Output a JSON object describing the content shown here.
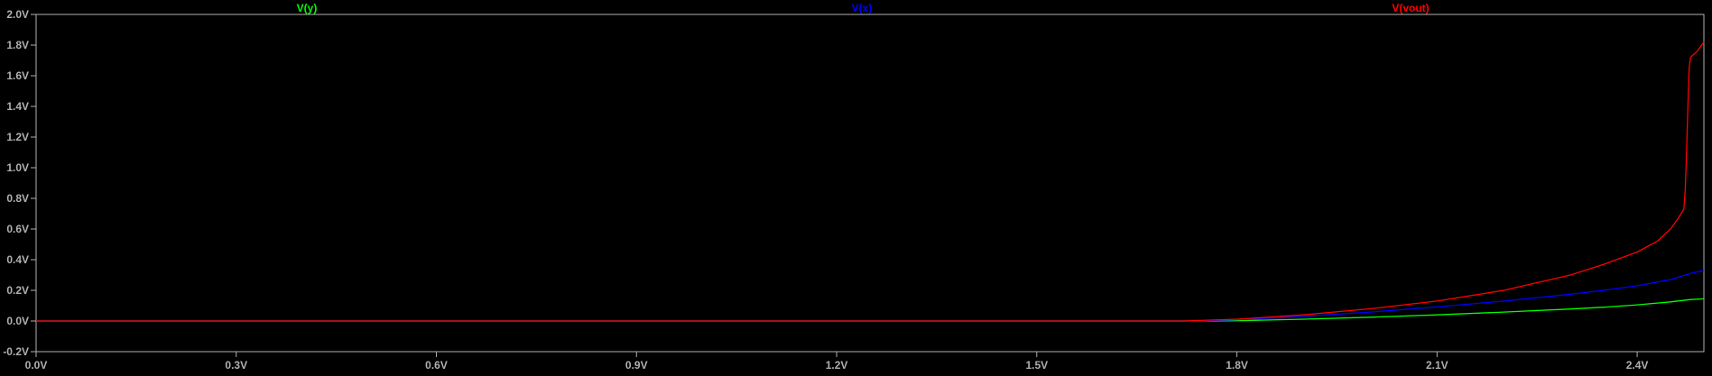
{
  "chart_data": {
    "type": "line",
    "title": "",
    "xlabel": "",
    "ylabel": "",
    "xlim": [
      0.0,
      2.5
    ],
    "ylim": [
      -0.2,
      2.0
    ],
    "grid": false,
    "legend": "top",
    "background": "#000000",
    "axis_color": "#b0b0b0",
    "x_ticks": [
      "0.0V",
      "0.3V",
      "0.6V",
      "0.9V",
      "1.2V",
      "1.5V",
      "1.8V",
      "2.1V",
      "2.4V"
    ],
    "x_tick_values": [
      0.0,
      0.3,
      0.6,
      0.9,
      1.2,
      1.5,
      1.8,
      2.1,
      2.4
    ],
    "y_ticks": [
      "-0.2V",
      "0.0V",
      "0.2V",
      "0.4V",
      "0.6V",
      "0.8V",
      "1.0V",
      "1.2V",
      "1.4V",
      "1.6V",
      "1.8V",
      "2.0V"
    ],
    "y_tick_values": [
      -0.2,
      0.0,
      0.2,
      0.4,
      0.6,
      0.8,
      1.0,
      1.2,
      1.4,
      1.6,
      1.8,
      2.0
    ],
    "series": [
      {
        "name": "V(y)",
        "color": "#00ff00",
        "x": [
          0.0,
          1.76,
          1.8,
          1.9,
          2.0,
          2.1,
          2.2,
          2.3,
          2.35,
          2.4,
          2.45,
          2.48,
          2.5
        ],
        "y": [
          0.0,
          0.0,
          0.002,
          0.012,
          0.025,
          0.04,
          0.058,
          0.078,
          0.09,
          0.105,
          0.125,
          0.14,
          0.145
        ]
      },
      {
        "name": "V(x)",
        "color": "#0000ff",
        "x": [
          0.0,
          1.74,
          1.8,
          1.9,
          2.0,
          2.1,
          2.2,
          2.3,
          2.35,
          2.4,
          2.45,
          2.48,
          2.5
        ],
        "y": [
          0.0,
          0.0,
          0.008,
          0.03,
          0.058,
          0.092,
          0.13,
          0.175,
          0.2,
          0.23,
          0.27,
          0.31,
          0.33
        ]
      },
      {
        "name": "V(vout)",
        "color": "#ff0000",
        "x": [
          0.0,
          1.72,
          1.8,
          1.9,
          2.0,
          2.1,
          2.2,
          2.3,
          2.35,
          2.4,
          2.43,
          2.45,
          2.46,
          2.47,
          2.472,
          2.474,
          2.476,
          2.478,
          2.48,
          2.49,
          2.5
        ],
        "y": [
          0.0,
          0.0,
          0.012,
          0.04,
          0.08,
          0.13,
          0.2,
          0.3,
          0.37,
          0.45,
          0.52,
          0.6,
          0.66,
          0.73,
          0.85,
          1.1,
          1.4,
          1.65,
          1.72,
          1.76,
          1.82
        ]
      }
    ]
  }
}
